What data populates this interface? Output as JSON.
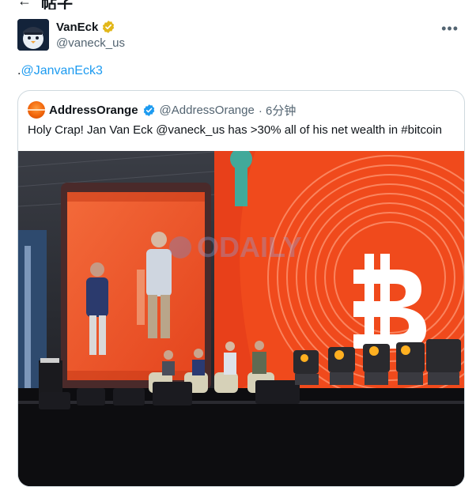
{
  "topbar": {
    "back_glyph": "←",
    "title": "帖子"
  },
  "author": {
    "name": "VanEck",
    "handle": "@vaneck_us",
    "verified": "gold-check",
    "more_glyph": "•••"
  },
  "tweet": {
    "prefix": ".",
    "mention": "@JanvanEck3"
  },
  "quote": {
    "name": "AddressOrange",
    "verified": "blue-check",
    "handle": "@AddressOrange",
    "time": "· 6分钟",
    "text": "Holy Crap!  Jan Van Eck @vaneck_us has >30% all of his net wealth in #bitcoin"
  },
  "photo": {
    "watermark": "ODAILY",
    "description_icon": "conference-stage-photo"
  },
  "colors": {
    "link": "#1d9bf0",
    "gold": "#e2b719",
    "blue": "#1d9bf0",
    "stage_orange": "#f04a1c"
  }
}
